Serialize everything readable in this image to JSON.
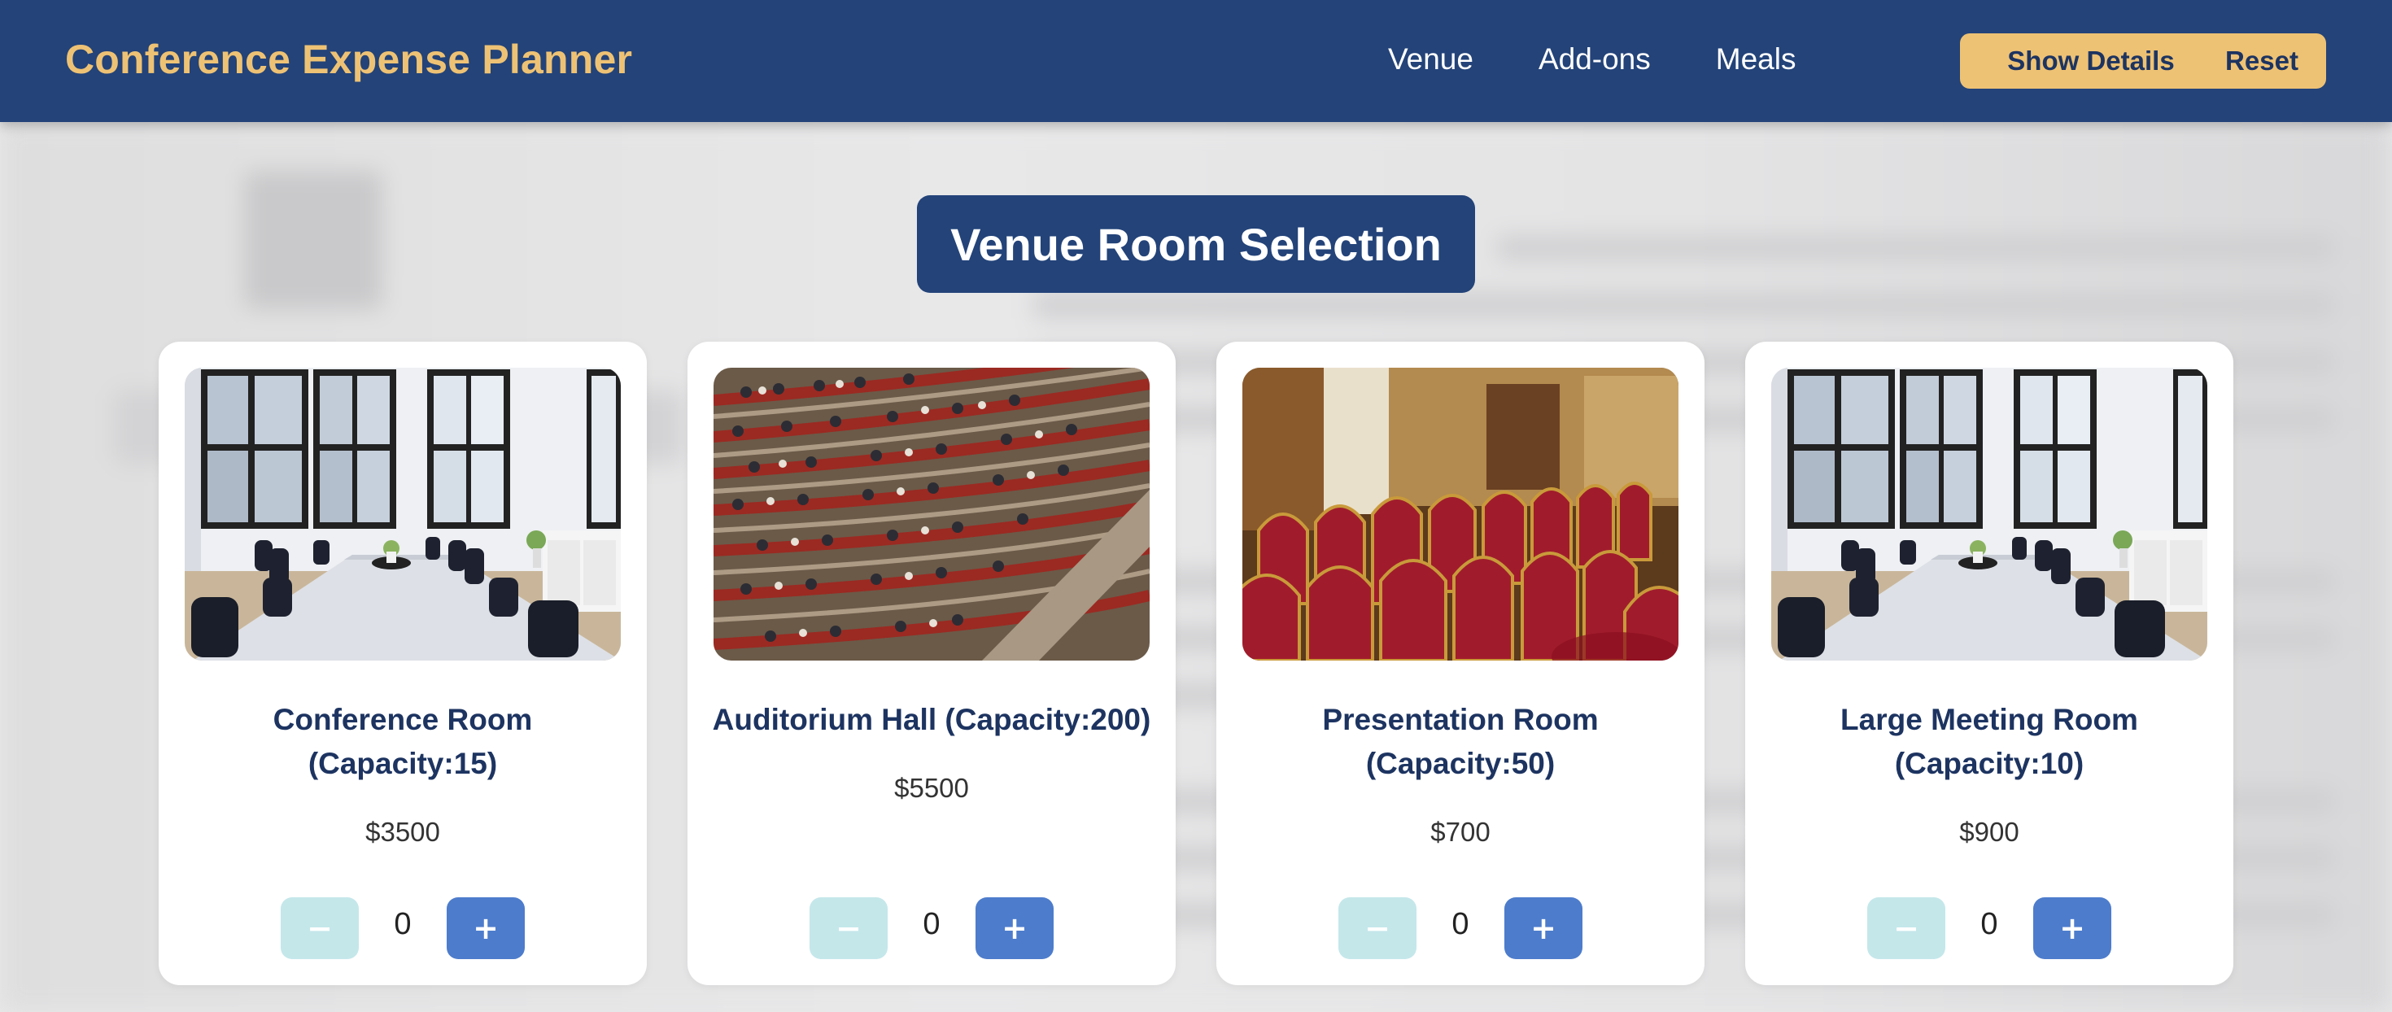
{
  "header": {
    "title": "Conference Expense Planner",
    "nav": [
      "Venue",
      "Add-ons",
      "Meals"
    ],
    "show_details_label": "Show Details",
    "reset_label": "Reset"
  },
  "section_title": "Venue Room Selection",
  "rooms": [
    {
      "name": "Conference Room (Capacity:15)",
      "price": "$3500",
      "quantity": "0",
      "minus": "−",
      "plus": "+",
      "image": "conference-room-photo"
    },
    {
      "name": "Auditorium Hall (Capacity:200)",
      "price": "$5500",
      "quantity": "0",
      "minus": "−",
      "plus": "+",
      "image": "auditorium-photo"
    },
    {
      "name": "Presentation Room (Capacity:50)",
      "price": "$700",
      "quantity": "0",
      "minus": "−",
      "plus": "+",
      "image": "presentation-room-photo"
    },
    {
      "name": "Large Meeting Room (Capacity:10)",
      "price": "$900",
      "quantity": "0",
      "minus": "−",
      "plus": "+",
      "image": "conference-room-photo"
    }
  ],
  "colors": {
    "header_bg": "#234379",
    "brand_gold": "#eec274",
    "plus_button": "#4d7ccc",
    "minus_button": "#c4e7ea"
  }
}
